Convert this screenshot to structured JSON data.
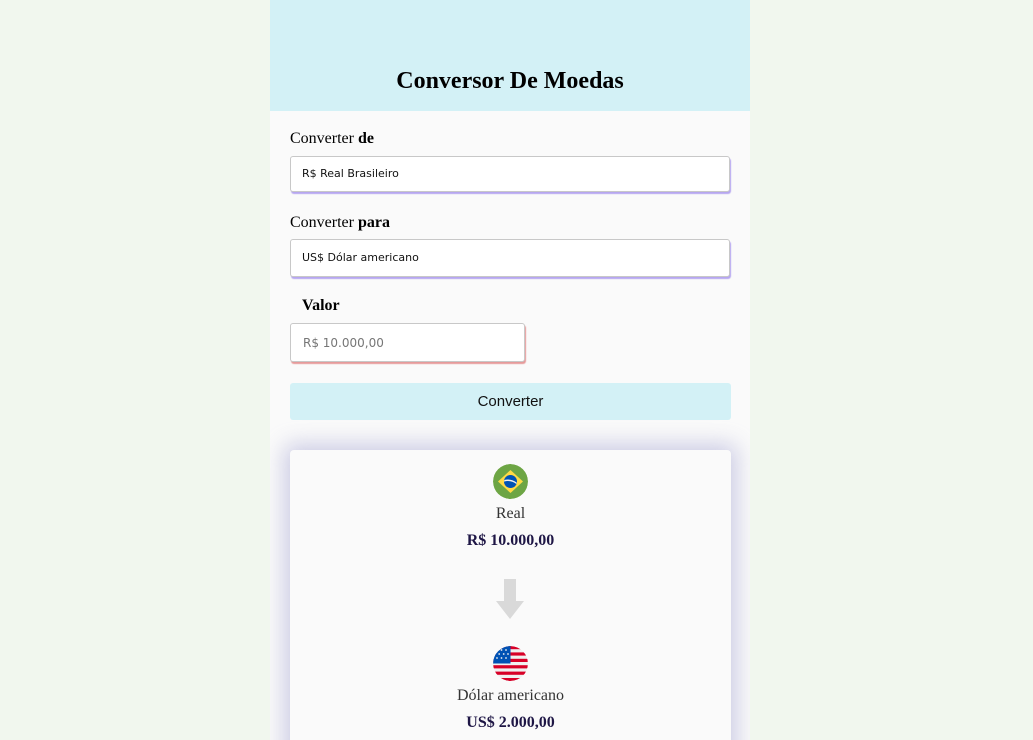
{
  "header": {
    "title": "Conversor De Moedas"
  },
  "form": {
    "from": {
      "label_prefix": "Converter",
      "label_bold": "de",
      "selected": "R$ Real Brasileiro"
    },
    "to": {
      "label_prefix": "Converter",
      "label_bold": "para",
      "selected": "US$ Dólar americano"
    },
    "amount": {
      "label": "Valor",
      "placeholder": "R$ 10.000,00",
      "value": ""
    },
    "convert_label": "Converter"
  },
  "result": {
    "source": {
      "flag_icon": "brazil-flag-icon",
      "name": "Real",
      "value": "R$ 10.000,00"
    },
    "arrow_icon": "arrow-down-icon",
    "target": {
      "flag_icon": "usa-flag-icon",
      "name": "Dólar americano",
      "value": "US$ 2.000,00"
    }
  },
  "colors": {
    "page_background": "#f1f7ee",
    "header_background": "#d3f1f6",
    "panel_background": "#fafafa",
    "button_background": "#d3f1f6",
    "select_shadow": "#b6a6f0",
    "input_shadow": "#e69a9a",
    "value_text": "#1e1645"
  }
}
